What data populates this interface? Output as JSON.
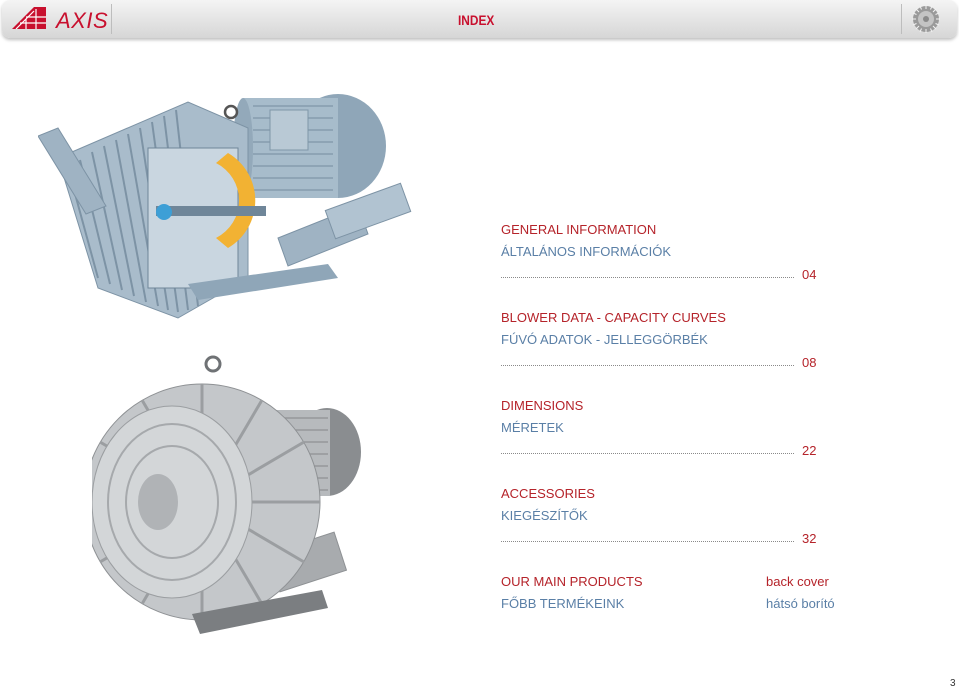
{
  "header": {
    "logo_text": "AXIS",
    "title": "INDEX"
  },
  "toc": [
    {
      "en": "GENERAL INFORMATION",
      "hu": "ÁLTALÁNOS INFORMÁCIÓK",
      "page": "04"
    },
    {
      "en": "BLOWER DATA - CAPACITY CURVES",
      "hu": "FÚVÓ ADATOK - JELLEGGÖRBÉK",
      "page": "08"
    },
    {
      "en": "DIMENSIONS",
      "hu": "MÉRETEK",
      "page": "22"
    },
    {
      "en": "ACCESSORIES",
      "hu": "KIEGÉSZÍTŐK",
      "page": "32"
    }
  ],
  "main_products": {
    "en": "OUR MAIN PRODUCTS",
    "hu": "FŐBB TERMÉKEINK",
    "page_en": "back cover",
    "page_hu": "hátsó borító"
  },
  "page_number": "3",
  "colors": {
    "accent_red": "#b5232a",
    "secondary_blue": "#5a7fa6"
  },
  "icons": [
    "axis-logo-icon",
    "gear-icon"
  ]
}
